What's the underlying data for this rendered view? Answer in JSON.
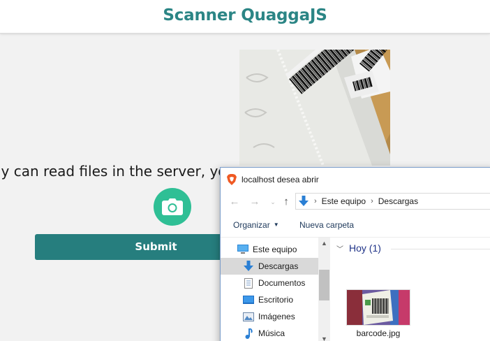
{
  "page": {
    "title": "Scanner QuaggaJS",
    "notice_text": "ly can read files in the server, yo",
    "submit_label": "Submit",
    "camera_icon": "camera-icon",
    "preview_icon": "barcode-photo-preview",
    "colors": {
      "title": "#2b8585",
      "submit_bg": "#267e7e",
      "camera_bg": "#2fbf95"
    }
  },
  "dialog": {
    "title": "localhost desea abrir",
    "browser_icon": "brave-lion-icon",
    "nav": {
      "back_icon": "back-arrow-icon",
      "forward_icon": "forward-arrow-icon",
      "up_icon": "up-arrow-icon"
    },
    "address": {
      "icon": "downloads-icon",
      "segments": [
        "Este equipo",
        "Descargas"
      ]
    },
    "toolbar": {
      "organize_label": "Organizar",
      "new_folder_label": "Nueva carpeta"
    },
    "tree": [
      {
        "label": "Este equipo",
        "icon": "computer-icon"
      },
      {
        "label": "Descargas",
        "icon": "downloads-icon"
      },
      {
        "label": "Documentos",
        "icon": "documents-icon"
      },
      {
        "label": "Escritorio",
        "icon": "desktop-icon"
      },
      {
        "label": "Imágenes",
        "icon": "pictures-icon"
      },
      {
        "label": "Música",
        "icon": "music-icon"
      }
    ],
    "group": {
      "label": "Hoy (1)"
    },
    "files": [
      {
        "name": "barcode.jpg",
        "icon": "image-thumbnail"
      }
    ]
  }
}
